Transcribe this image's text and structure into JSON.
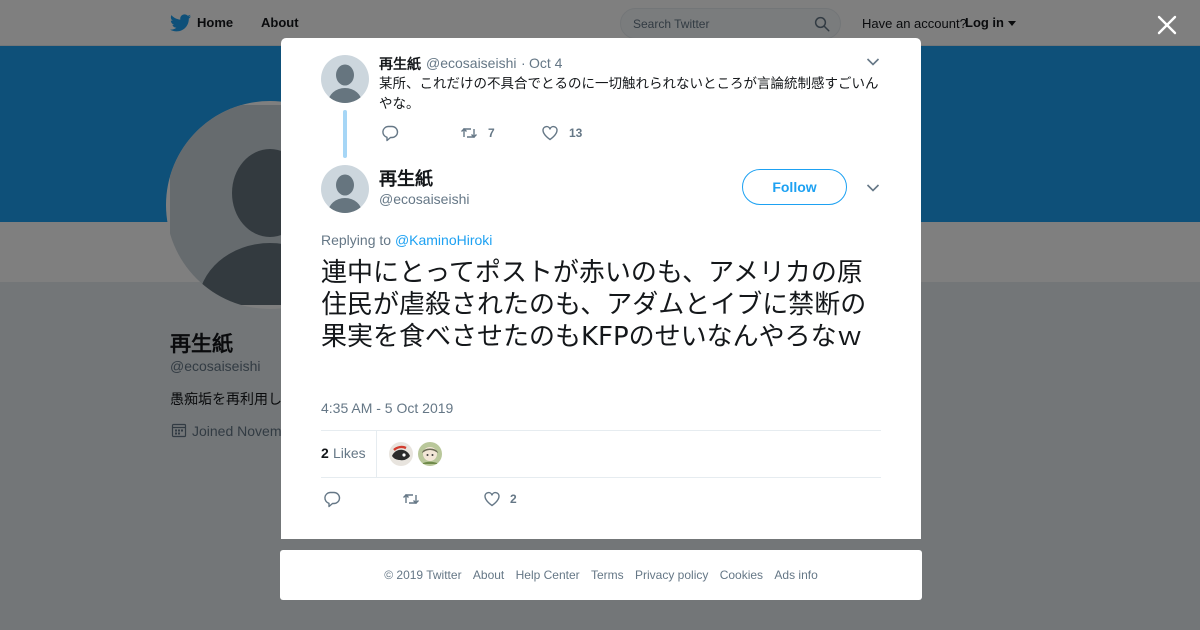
{
  "colors": {
    "accent": "#1da1f2",
    "banner": "#1da1f2",
    "thread_line": "#a6d6f6",
    "muted": "#657786",
    "text": "#14171a"
  },
  "topbar": {
    "logo_icon": "twitter-bird-icon",
    "nav": {
      "home": "Home",
      "about": "About"
    },
    "search": {
      "placeholder": "Search Twitter",
      "icon": "search-icon"
    },
    "account_prompt": "Have an account?",
    "login_label": "Log in"
  },
  "profile": {
    "name": "再生紙",
    "handle": "@ecosaiseishi",
    "bio_visible": "愚痴垢を再利用し",
    "joined_visible": "Joined Novem"
  },
  "modal": {
    "close_icon": "close-icon",
    "parent_tweet": {
      "name": "再生紙",
      "handle": "@ecosaiseishi",
      "separator": "·",
      "date": "Oct 4",
      "text": "某所、これだけの不具合でとるのに一切触れられないところが言論統制感すごいんやな。",
      "actions": {
        "replies": "",
        "retweets": "7",
        "likes": "13"
      }
    },
    "main_tweet": {
      "name": "再生紙",
      "handle": "@ecosaiseishi",
      "follow_label": "Follow",
      "replying_prefix": "Replying to",
      "replying_to": "@KaminoHiroki",
      "text": "連中にとってポストが赤いのも、アメリカの原住民が虐殺されたのも、アダムとイブに禁断の果実を食べさせたのもKFPのせいなんやろなｗ",
      "timestamp": "4:35 AM - 5 Oct 2019",
      "likes_count": "2",
      "likes_label": "Likes",
      "actions": {
        "replies": "",
        "retweets": "",
        "likes": "2"
      }
    }
  },
  "footer": {
    "copyright": "© 2019 Twitter",
    "links": [
      "About",
      "Help Center",
      "Terms",
      "Privacy policy",
      "Cookies",
      "Ads info"
    ]
  }
}
